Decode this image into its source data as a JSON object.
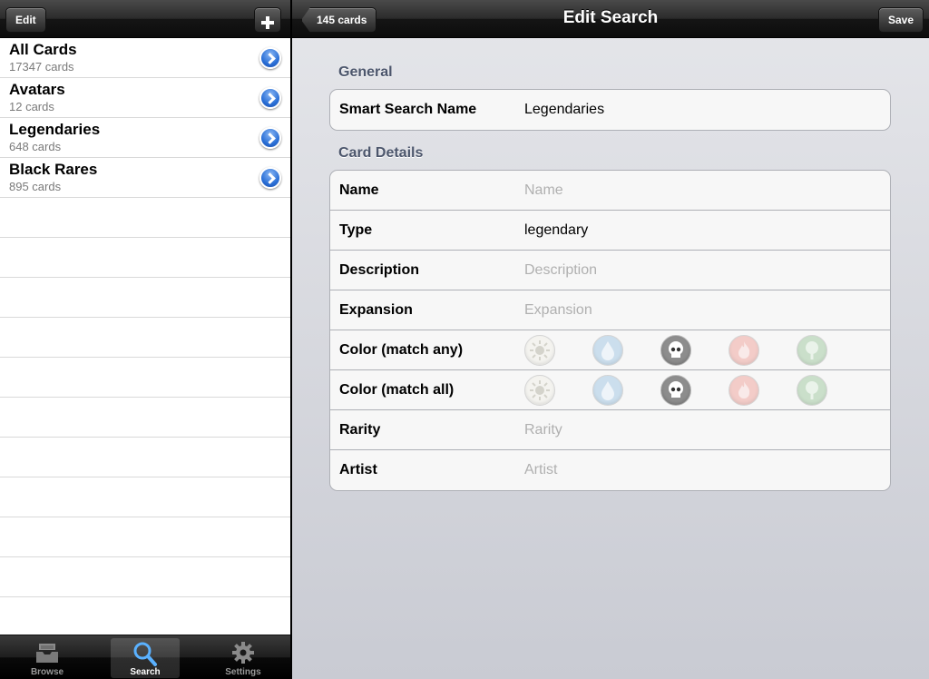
{
  "left": {
    "edit_label": "Edit",
    "searches": [
      {
        "title": "All Cards",
        "subtitle": "17347 cards"
      },
      {
        "title": "Avatars",
        "subtitle": "12 cards"
      },
      {
        "title": "Legendaries",
        "subtitle": "648 cards"
      },
      {
        "title": "Black Rares",
        "subtitle": "895 cards"
      }
    ]
  },
  "tabbar": {
    "tabs": [
      {
        "label": "Browse",
        "icon": "inbox-tray-icon"
      },
      {
        "label": "Search",
        "icon": "magnifier-icon",
        "selected": true
      },
      {
        "label": "Settings",
        "icon": "gear-icon"
      }
    ]
  },
  "right": {
    "back_label": "145 cards",
    "title": "Edit Search",
    "save_label": "Save",
    "general": {
      "header": "General",
      "smart_search_label": "Smart Search Name",
      "smart_search_value": "Legendaries"
    },
    "details": {
      "header": "Card Details",
      "name": {
        "label": "Name",
        "value": "",
        "placeholder": "Name"
      },
      "type": {
        "label": "Type",
        "value": "legendary",
        "placeholder": ""
      },
      "description": {
        "label": "Description",
        "value": "",
        "placeholder": "Description"
      },
      "expansion": {
        "label": "Expansion",
        "value": "",
        "placeholder": "Expansion"
      },
      "color_any": {
        "label": "Color (match any)"
      },
      "color_all": {
        "label": "Color (match all)"
      },
      "rarity": {
        "label": "Rarity",
        "value": "",
        "placeholder": "Rarity"
      },
      "artist": {
        "label": "Artist",
        "value": "",
        "placeholder": "Artist"
      }
    },
    "colors": [
      {
        "name": "white",
        "icon": "sun-icon",
        "hex": "#f2f1ea"
      },
      {
        "name": "blue",
        "icon": "water-drop-icon",
        "hex": "#a8cbe6"
      },
      {
        "name": "black",
        "icon": "skull-icon",
        "hex": "#8d8d8d"
      },
      {
        "name": "red",
        "icon": "fire-icon",
        "hex": "#f0a9a2"
      },
      {
        "name": "green",
        "icon": "tree-icon",
        "hex": "#a6cda6"
      }
    ]
  }
}
